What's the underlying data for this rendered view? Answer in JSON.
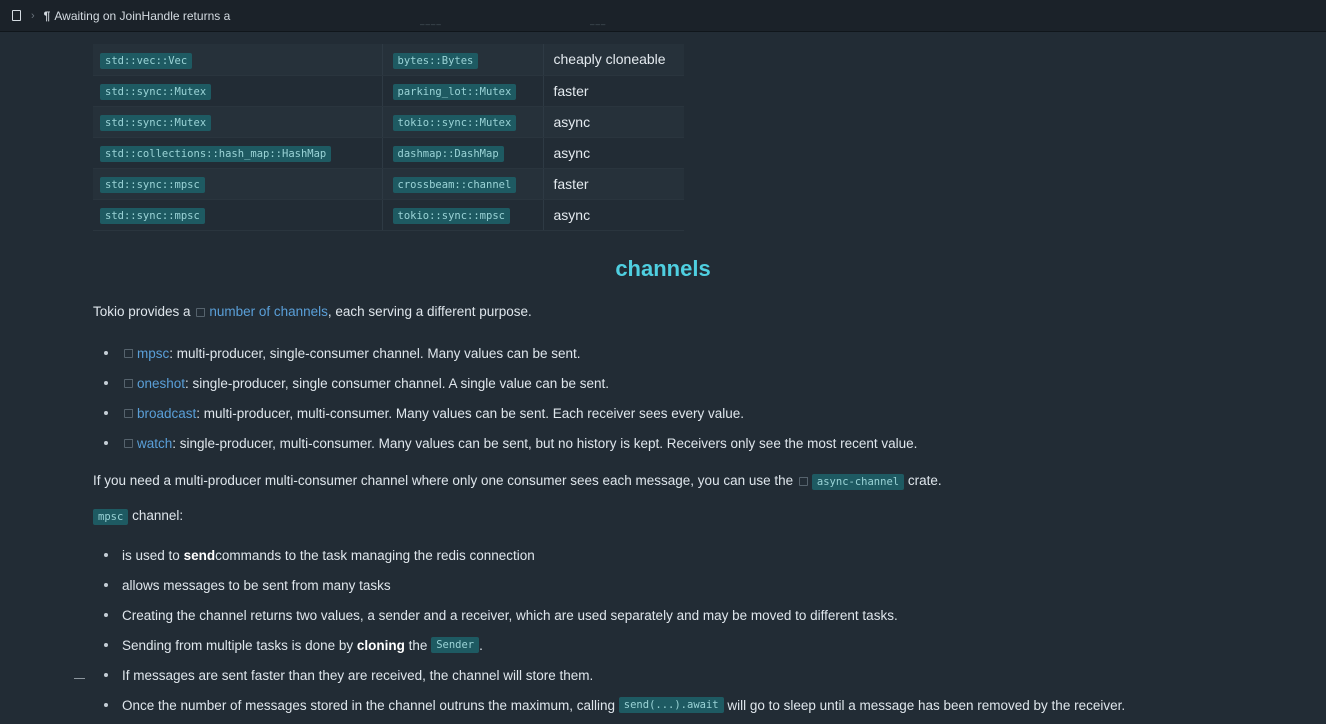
{
  "breadcrumb": {
    "title": "Awaiting on JoinHandle returns a"
  },
  "table": {
    "rows": [
      {
        "std": "std::vec::Vec",
        "crate": "bytes::Bytes",
        "note": "cheaply cloneable"
      },
      {
        "std": "std::sync::Mutex",
        "crate": "parking_lot::Mutex",
        "note": "faster"
      },
      {
        "std": "std::sync::Mutex",
        "crate": "tokio::sync::Mutex",
        "note": "async"
      },
      {
        "std": "std::collections::hash_map::HashMap",
        "crate": "dashmap::DashMap",
        "note": "async"
      },
      {
        "std": "std::sync::mpsc",
        "crate": "crossbeam::channel",
        "note": "faster"
      },
      {
        "std": "std::sync::mpsc",
        "crate": "tokio::sync::mpsc",
        "note": "async"
      }
    ]
  },
  "heading": "channels",
  "intro": {
    "before": "Tokio provides a",
    "link": "number of channels",
    "after": ", each serving a different purpose."
  },
  "channels": [
    {
      "name": "mpsc",
      "desc": ": multi-producer, single-consumer channel. Many values can be sent."
    },
    {
      "name": "oneshot",
      "desc": ": single-producer, single consumer channel. A single value can be sent."
    },
    {
      "name": "broadcast",
      "desc": ": multi-producer, multi-consumer. Many values can be sent. Each receiver sees every value."
    },
    {
      "name": "watch",
      "desc": ": single-producer, multi-consumer. Many values can be sent, but no history is kept. Receivers only see the most recent value."
    }
  ],
  "mpmc": {
    "before": "If you need a multi-producer multi-consumer channel where only one consumer sees each message, you can use the",
    "code": "async-channel",
    "after": "crate."
  },
  "mpsc_label": {
    "code": "mpsc",
    "text": "channel:"
  },
  "mpsc_points": {
    "p1_before": "is used to ",
    "p1_bold": "send",
    "p1_after": " commands to the task managing the redis connection",
    "p2": "allows messages to be sent from many tasks",
    "p3": "Creating the channel returns two values, a sender and a receiver, which are used separately and may be moved to different tasks.",
    "p4_before": "Sending from multiple tasks is done by ",
    "p4_bold": "cloning",
    "p4_mid": " the ",
    "p4_code": "Sender",
    "p4_after": ".",
    "p5": "If messages are sent faster than they are received, the channel will store them.",
    "p6_before": "Once the number of messages stored in the channel outruns the maximum, calling ",
    "p6_code": "send(...).await",
    "p6_after": " will go to sleep until a message has been removed by the receiver."
  }
}
